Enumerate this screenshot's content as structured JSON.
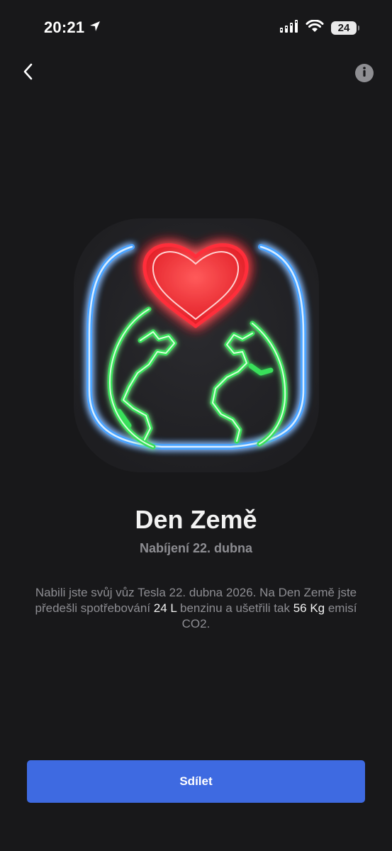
{
  "status_bar": {
    "time": "20:21",
    "battery_level": "24",
    "icons": [
      "location-arrow-icon",
      "signal-icon",
      "wifi-icon",
      "battery-icon"
    ]
  },
  "nav": {
    "back_icon": "chevron-left-icon",
    "info_icon": "info-icon"
  },
  "badge": {
    "icon": "earth-day-neon-badge",
    "colors": {
      "heart": "#ff2d3a",
      "globe": "#39e05a",
      "frame": "#4aa3ff"
    }
  },
  "title": "Den Země",
  "subtitle": "Nabíjení 22. dubna",
  "description": {
    "part1": "Nabili jste svůj vůz Tesla 22. dubna 2026. Na Den Země jste předešli spotřebování ",
    "fuel_amount": "24 L",
    "part2": " benzinu a ušetřili tak ",
    "co2_amount": "56 Kg",
    "part3": " emisí CO2."
  },
  "share_button": {
    "label": "Sdílet",
    "color": "#3e6ae1"
  }
}
